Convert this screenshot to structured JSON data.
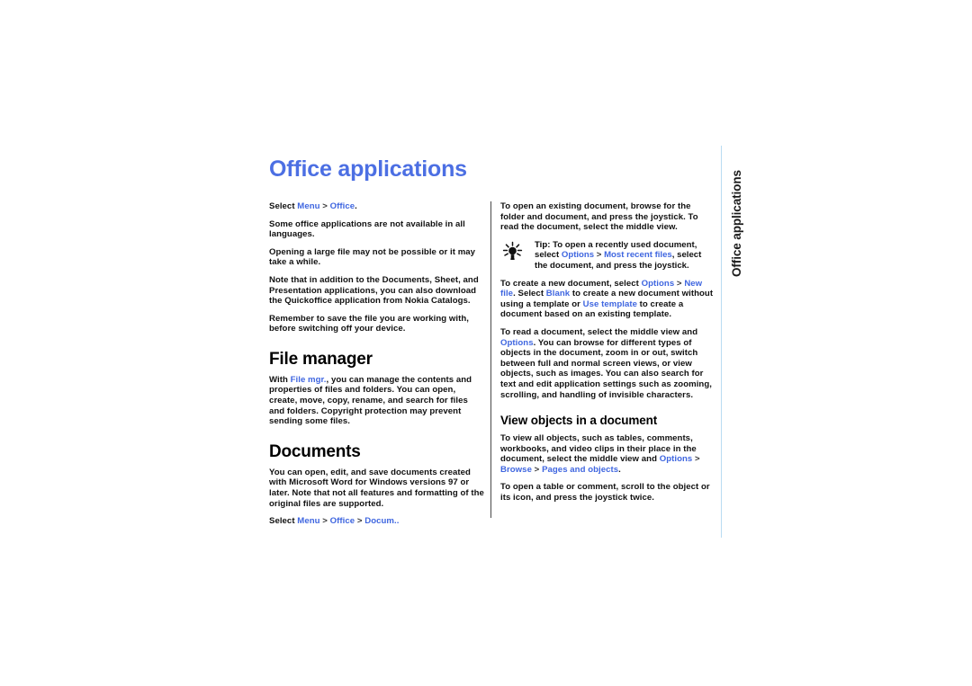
{
  "page": {
    "title": "Office applications",
    "side_tab": "Office applications",
    "title_color": "#4c6fe3",
    "link_color": "#3f66e0",
    "rule_color": "#4a4a4a",
    "edge_rule_color": "#b9dcf2"
  },
  "left_column": {
    "select_line": {
      "prefix": "Select ",
      "link1": "Menu",
      "sep1": " > ",
      "link2": "Office",
      "suffix": "."
    },
    "para_languages": "Some office applications are not available in all languages.",
    "para_large_file": "Opening a large file may not be possible or it may take a while.",
    "para_quickoffice": "Note that in addition to the Documents, Sheet, and Presentation applications, you can also download the Quickoffice application from Nokia Catalogs.",
    "para_remember_save": "Remember to save the file you are working with, before switching off your device.",
    "file_manager": {
      "heading": "File manager",
      "body_prefix": "With ",
      "body_link": "File mgr.",
      "body_suffix": ", you can manage the contents and properties of files and folders. You can open, create, move, copy, rename, and search for files and folders. Copyright protection may prevent sending some files."
    },
    "documents": {
      "heading": "Documents",
      "para1": "You can open, edit, and save documents created with Microsoft Word for Windows versions 97 or later. Note that not all features and formatting of the original files are supported.",
      "select_line": {
        "prefix": "Select ",
        "link1": "Menu",
        "sep1": " > ",
        "link2": "Office",
        "sep2": " > ",
        "link3": "Docum..",
        "suffix": ""
      }
    }
  },
  "right_column": {
    "para_open_existing": "To open an existing document, browse for the folder and document, and press the joystick. To read the document, select the middle view.",
    "tip": {
      "icon_name": "lightbulb-tip-icon",
      "label": "Tip:",
      "text_before": " To open a recently used document, select ",
      "link1": "Options",
      "sep1": " > ",
      "link2": "Most recent files",
      "text_after": ", select the document, and press the joystick."
    },
    "para_create_new": {
      "p1": "To create a new document, select ",
      "link1": "Options",
      "sep1": " > ",
      "link2": "New file",
      "p2": ". Select ",
      "link3": "Blank",
      "p3": " to create a new document without using a template or ",
      "link4": "Use template",
      "p4": " to create a document based on an existing template."
    },
    "para_read_doc": {
      "p1": "To read a document, select the middle view and ",
      "link1": "Options",
      "p2": ". You can browse for different types of objects in the document, zoom in or out, switch between full and normal screen views, or view objects, such as images. You can also search for text and edit application settings such as zooming, scrolling, and handling of invisible characters."
    },
    "view_objects": {
      "heading": "View objects in a document",
      "para1": {
        "p1": "To view all objects, such as tables, comments, workbooks, and video clips in their place in the document, select the middle view and ",
        "link1": "Options",
        "sep1": " > ",
        "link2": "Browse",
        "sep2": " > ",
        "link3": "Pages and objects",
        "p2": "."
      },
      "para2": "To open a table or comment, scroll to the object or its icon, and press the joystick twice."
    }
  }
}
